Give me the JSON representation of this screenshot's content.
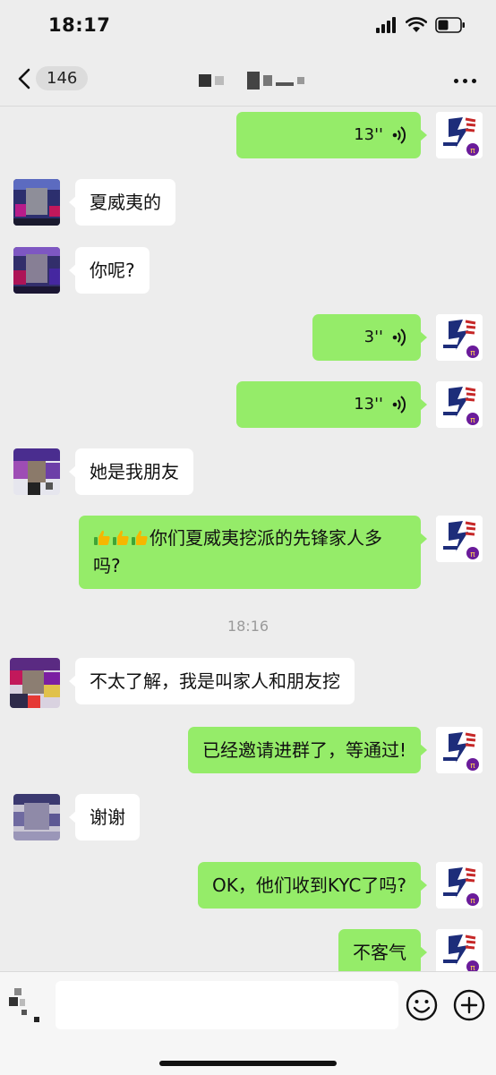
{
  "status_bar": {
    "time": "18:17"
  },
  "header": {
    "unread_count": "146"
  },
  "colors": {
    "outgoing_bubble": "#95EC69",
    "incoming_bubble": "#FFFFFF",
    "background": "#EDEDED"
  },
  "messages": [
    {
      "direction": "out",
      "type": "voice",
      "duration": "13''"
    },
    {
      "direction": "in",
      "type": "text",
      "text": "夏威夷的"
    },
    {
      "direction": "in",
      "type": "text",
      "text": "你呢?"
    },
    {
      "direction": "out",
      "type": "voice",
      "duration": "3''"
    },
    {
      "direction": "out",
      "type": "voice",
      "duration": "13''"
    },
    {
      "direction": "in",
      "type": "text",
      "text": "她是我朋友"
    },
    {
      "direction": "out",
      "type": "text",
      "prefix_icons": [
        "thumbs-up-icon",
        "thumbs-up-icon",
        "thumbs-up-icon"
      ],
      "text": "你们夏威夷挖派的先锋家人多吗?"
    },
    {
      "type": "timestamp",
      "text": "18:16"
    },
    {
      "direction": "in",
      "type": "text",
      "text": "不太了解，我是叫家人和朋友挖"
    },
    {
      "direction": "out",
      "type": "text",
      "text": "已经邀请进群了，等通过!"
    },
    {
      "direction": "in",
      "type": "text",
      "text": "谢谢"
    },
    {
      "direction": "out",
      "type": "text",
      "text": "OK，他们收到KYC了吗?"
    },
    {
      "direction": "out",
      "type": "text",
      "text": "不客气"
    }
  ],
  "input_bar": {
    "placeholder": ""
  }
}
